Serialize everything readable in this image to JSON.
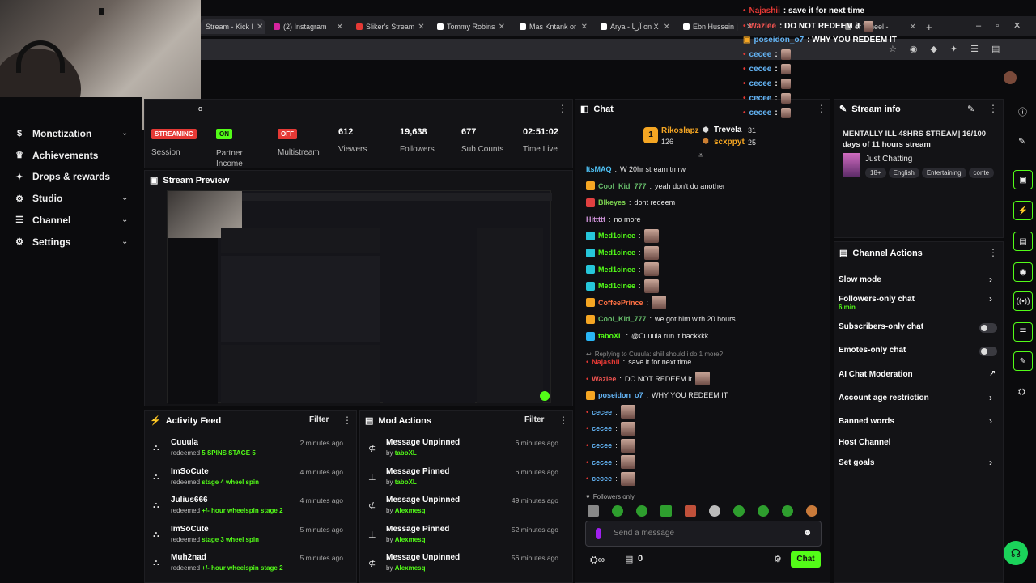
{
  "browser": {
    "tabs": [
      {
        "label": "Stream - Kick I"
      },
      {
        "label": "(2) Instagram"
      },
      {
        "label": "Sliker's Stream"
      },
      {
        "label": "Tommy Robins"
      },
      {
        "label": "Mas Kntank or"
      },
      {
        "label": "Arya - آريا on X"
      },
      {
        "label": "Ebn Hussein |"
      },
      {
        "label": "er Wheel -"
      }
    ],
    "new_tab": "+"
  },
  "sidebar": {
    "items": [
      {
        "label": "Monetization",
        "icon": "dollar-icon",
        "chevron": true
      },
      {
        "label": "Achievements",
        "icon": "trophy-icon",
        "chevron": false
      },
      {
        "label": "Drops & rewards",
        "icon": "gift-icon",
        "chevron": false
      },
      {
        "label": "Studio",
        "icon": "gear-icon",
        "chevron": true
      },
      {
        "label": "Channel",
        "icon": "list-icon",
        "chevron": true
      },
      {
        "label": "Settings",
        "icon": "settings-icon",
        "chevron": true
      }
    ]
  },
  "stats": {
    "session": {
      "badge": "STREAMING",
      "label": "Session"
    },
    "partner": {
      "badge": "ON",
      "label": "Partner Income"
    },
    "multistream": {
      "badge": "OFF",
      "label": "Multistream"
    },
    "viewers": {
      "value": "612",
      "label": "Viewers"
    },
    "followers": {
      "value": "19,638",
      "label": "Followers"
    },
    "subs": {
      "value": "677",
      "label": "Sub Counts"
    },
    "time": {
      "value": "02:51:02",
      "label": "Time Live"
    }
  },
  "preview": {
    "title": "Stream Preview"
  },
  "activity": {
    "title": "Activity Feed",
    "filter": "Filter",
    "rows": [
      {
        "name": "Cuuula",
        "action": "redeemed",
        "item": "5 SPINS STAGE 5",
        "time": "2 minutes ago"
      },
      {
        "name": "ImSoCute",
        "action": "redeemed",
        "item": "stage 4 wheel spin",
        "time": "4 minutes ago"
      },
      {
        "name": "Julius666",
        "action": "redeemed",
        "item": "+/- hour wheelspin stage 2",
        "time": "4 minutes ago"
      },
      {
        "name": "ImSoCute",
        "action": "redeemed",
        "item": "stage 3 wheel spin",
        "time": "5 minutes ago"
      },
      {
        "name": "Muh2nad",
        "action": "redeemed",
        "item": "+/- hour wheelspin stage 2",
        "time": "5 minutes ago"
      }
    ]
  },
  "mod": {
    "title": "Mod Actions",
    "filter": "Filter",
    "rows": [
      {
        "name": "Message Unpinned",
        "by": "by",
        "user": "taboXL",
        "time": "6 minutes ago"
      },
      {
        "name": "Message Pinned",
        "by": "by",
        "user": "taboXL",
        "time": "6 minutes ago"
      },
      {
        "name": "Message Unpinned",
        "by": "by",
        "user": "Alexmesq",
        "time": "49 minutes ago"
      },
      {
        "name": "Message Pinned",
        "by": "by",
        "user": "Alexmesq",
        "time": "52 minutes ago"
      },
      {
        "name": "Message Unpinned",
        "by": "by",
        "user": "Alexmesq",
        "time": "56 minutes ago"
      }
    ]
  },
  "chat": {
    "title": "Chat",
    "top": {
      "first": "Rikoslapz",
      "first_val": "126",
      "second": "Trevela",
      "second_val": "31",
      "third": "scxppyt",
      "third_val": "25"
    },
    "messages": [
      {
        "user": "ItsMAQ",
        "color": "#4fc3f7",
        "text": "W 20hr stream tmrw",
        "badge": "",
        "emote": false
      },
      {
        "user": "Cool_Kid_777",
        "color": "#66bb6a",
        "text": "yeah don't do another",
        "badge": "#f5a623",
        "emote": false
      },
      {
        "user": "Blkeyes",
        "color": "#7cd34f",
        "text": "dont redeem",
        "badge": "#e04040",
        "emote": false
      },
      {
        "user": "Hittttt",
        "color": "#ce93d8",
        "text": "no more",
        "badge": "",
        "emote": false
      },
      {
        "user": "Med1cinee",
        "color": "#53fc18",
        "text": "",
        "badge": "#26c6da",
        "emote": true
      },
      {
        "user": "Med1cinee",
        "color": "#53fc18",
        "text": "",
        "badge": "#26c6da",
        "emote": true
      },
      {
        "user": "Med1cinee",
        "color": "#53fc18",
        "text": "",
        "badge": "#26c6da",
        "emote": true
      },
      {
        "user": "Med1cinee",
        "color": "#53fc18",
        "text": "",
        "badge": "#26c6da",
        "emote": true
      },
      {
        "user": "CoffeePrince",
        "color": "#ff7043",
        "text": "",
        "badge": "#f5a623",
        "emote": true
      },
      {
        "user": "Cool_Kid_777",
        "color": "#66bb6a",
        "text": "we got him with 20 hours",
        "badge": "#f5a623",
        "emote": false
      },
      {
        "user": "taboXL",
        "color": "#53fc18",
        "text": "@Cuuula run it backkkk",
        "badge": "#29b6f6",
        "emote": false
      }
    ],
    "reply_note": "Replying to Cuuula: shiil should i do 1 more?",
    "messages2": [
      {
        "user": "Najashii",
        "color": "#e53935",
        "text": "save it for next time",
        "badge": "",
        "emote": false
      },
      {
        "user": "Wazlee",
        "color": "#ef5350",
        "text": "DO NOT REDEEM it",
        "badge": "",
        "emote": true
      },
      {
        "user": "poseidon_o7",
        "color": "#64b5f6",
        "text": "WHY YOU REDEEM IT",
        "badge": "#f5a623",
        "emote": false
      },
      {
        "user": "cecee",
        "color": "#64b5f6",
        "text": "",
        "badge": "",
        "emote": true
      },
      {
        "user": "cecee",
        "color": "#64b5f6",
        "text": "",
        "badge": "",
        "emote": true
      },
      {
        "user": "cecee",
        "color": "#64b5f6",
        "text": "",
        "badge": "",
        "emote": true
      },
      {
        "user": "cecee",
        "color": "#64b5f6",
        "text": "",
        "badge": "",
        "emote": true
      },
      {
        "user": "cecee",
        "color": "#64b5f6",
        "text": "",
        "badge": "",
        "emote": true
      }
    ],
    "followers_only": "Followers only",
    "input_placeholder": "Send a message",
    "count": "0",
    "send_label": "Chat"
  },
  "overlay": {
    "lines": [
      {
        "user": "Najashii",
        "text": ": save it for next time",
        "color": "#e53935"
      },
      {
        "user": "Wazlee",
        "text": ": DO NOT REDEEM it",
        "color": "#ef5350"
      },
      {
        "user": "poseidon_o7",
        "text": ": WHY YOU REDEEM IT",
        "color": "#64b5f6"
      },
      {
        "user": "cecee",
        "text": ":",
        "color": "#64b5f6"
      },
      {
        "user": "cecee",
        "text": ":",
        "color": "#64b5f6"
      },
      {
        "user": "cecee",
        "text": ":",
        "color": "#64b5f6"
      },
      {
        "user": "cecee",
        "text": ":",
        "color": "#64b5f6"
      },
      {
        "user": "cecee",
        "text": ":",
        "color": "#64b5f6"
      }
    ]
  },
  "stream_info": {
    "title": "Stream info",
    "stream_title": "MENTALLY ILL 48HRS STREAM| 16/100 days of 11 hours stream",
    "category": "Just Chatting",
    "tags": [
      "18+",
      "English",
      "Entertaining",
      "conte"
    ]
  },
  "channel_actions": {
    "title": "Channel Actions",
    "items": [
      {
        "label": "Slow mode",
        "sub": "",
        "control": "chevron"
      },
      {
        "label": "Followers-only chat",
        "sub": "6 min",
        "control": "chevron"
      },
      {
        "label": "Subscribers-only chat",
        "sub": "",
        "control": "toggle"
      },
      {
        "label": "Emotes-only chat",
        "sub": "",
        "control": "toggle"
      },
      {
        "label": "AI Chat Moderation",
        "sub": "",
        "control": "external"
      },
      {
        "label": "Account age restriction",
        "sub": "",
        "control": "chevron"
      },
      {
        "label": "Banned words",
        "sub": "",
        "control": "chevron"
      },
      {
        "label": "Host Channel",
        "sub": "",
        "control": "none"
      },
      {
        "label": "Set goals",
        "sub": "",
        "control": "chevron"
      }
    ]
  },
  "colors": {
    "accent": "#53fc18",
    "danger": "#e53935",
    "bg": "#0b0b0d",
    "panel": "#131316"
  }
}
